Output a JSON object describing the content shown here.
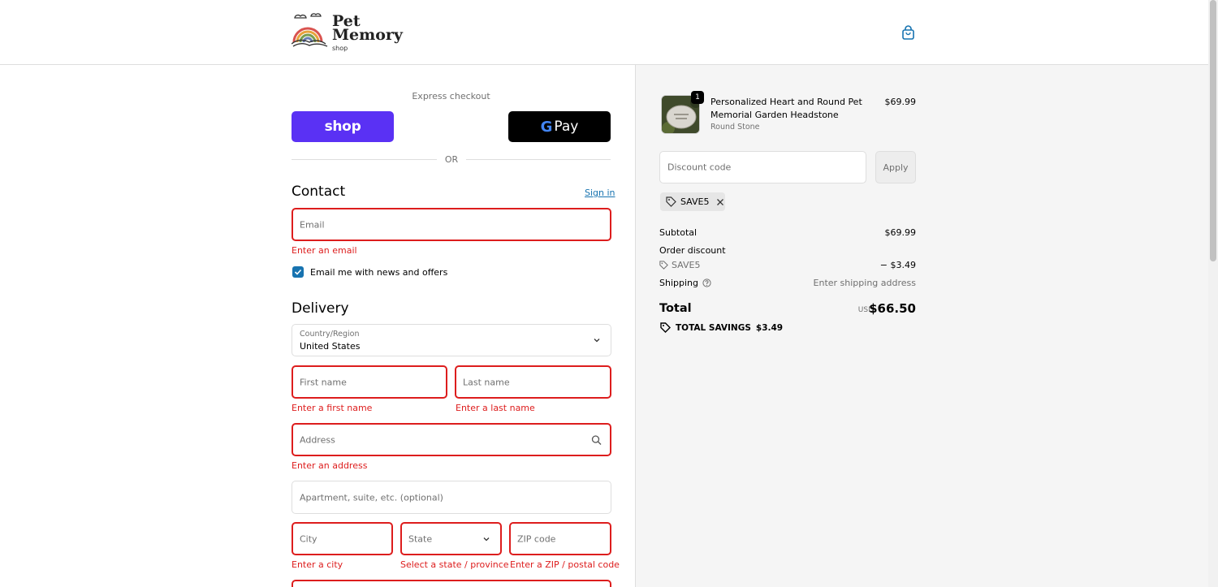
{
  "brand": {
    "line1": "Pet",
    "line2": "Memory",
    "line3": "shop"
  },
  "icons": {
    "cart": "shopping-bag-icon",
    "tag": "tag-icon",
    "close": "close-icon",
    "search": "search-icon",
    "chevron": "chevron-down-icon",
    "help": "help-circle-icon",
    "check": "check-icon"
  },
  "express": {
    "title": "Express checkout",
    "shop_pay_label": "shop",
    "gpay_g": "G",
    "gpay_label": "Pay",
    "or_label": "OR"
  },
  "contact": {
    "title": "Contact",
    "signin_label": "Sign in",
    "email_placeholder": "Email",
    "email_error": "Enter an email",
    "newsletter_label": "Email me with news and offers",
    "newsletter_checked": true
  },
  "delivery": {
    "title": "Delivery",
    "country_label": "Country/Region",
    "country_value": "United States",
    "first_name_placeholder": "First name",
    "first_name_error": "Enter a first name",
    "last_name_placeholder": "Last name",
    "last_name_error": "Enter a last name",
    "address_placeholder": "Address",
    "address_error": "Enter an address",
    "apartment_placeholder": "Apartment, suite, etc. (optional)",
    "city_placeholder": "City",
    "city_error": "Enter a city",
    "state_placeholder": "State",
    "state_error": "Select a state / province",
    "zip_placeholder": "ZIP code",
    "zip_error": "Enter a ZIP / postal code"
  },
  "order": {
    "item": {
      "quantity": "1",
      "name": "Personalized Heart and Round Pet Memorial Garden Headstone",
      "variant": "Round Stone",
      "price": "$69.99"
    },
    "discount_placeholder": "Discount code",
    "apply_label": "Apply",
    "applied_code": "SAVE5",
    "subtotal_label": "Subtotal",
    "subtotal_value": "$69.99",
    "order_discount_label": "Order discount",
    "discount_code": "SAVE5",
    "discount_value": "− $3.49",
    "shipping_label": "Shipping",
    "shipping_value": "Enter shipping address",
    "total_label": "Total",
    "total_currency": "USD",
    "total_value": "$66.50",
    "savings_label": "TOTAL SAVINGS",
    "savings_value": "$3.49"
  },
  "colors": {
    "accent": "#1773b0",
    "error": "#dd1d1d",
    "shop_pay": "#5a31f4"
  }
}
